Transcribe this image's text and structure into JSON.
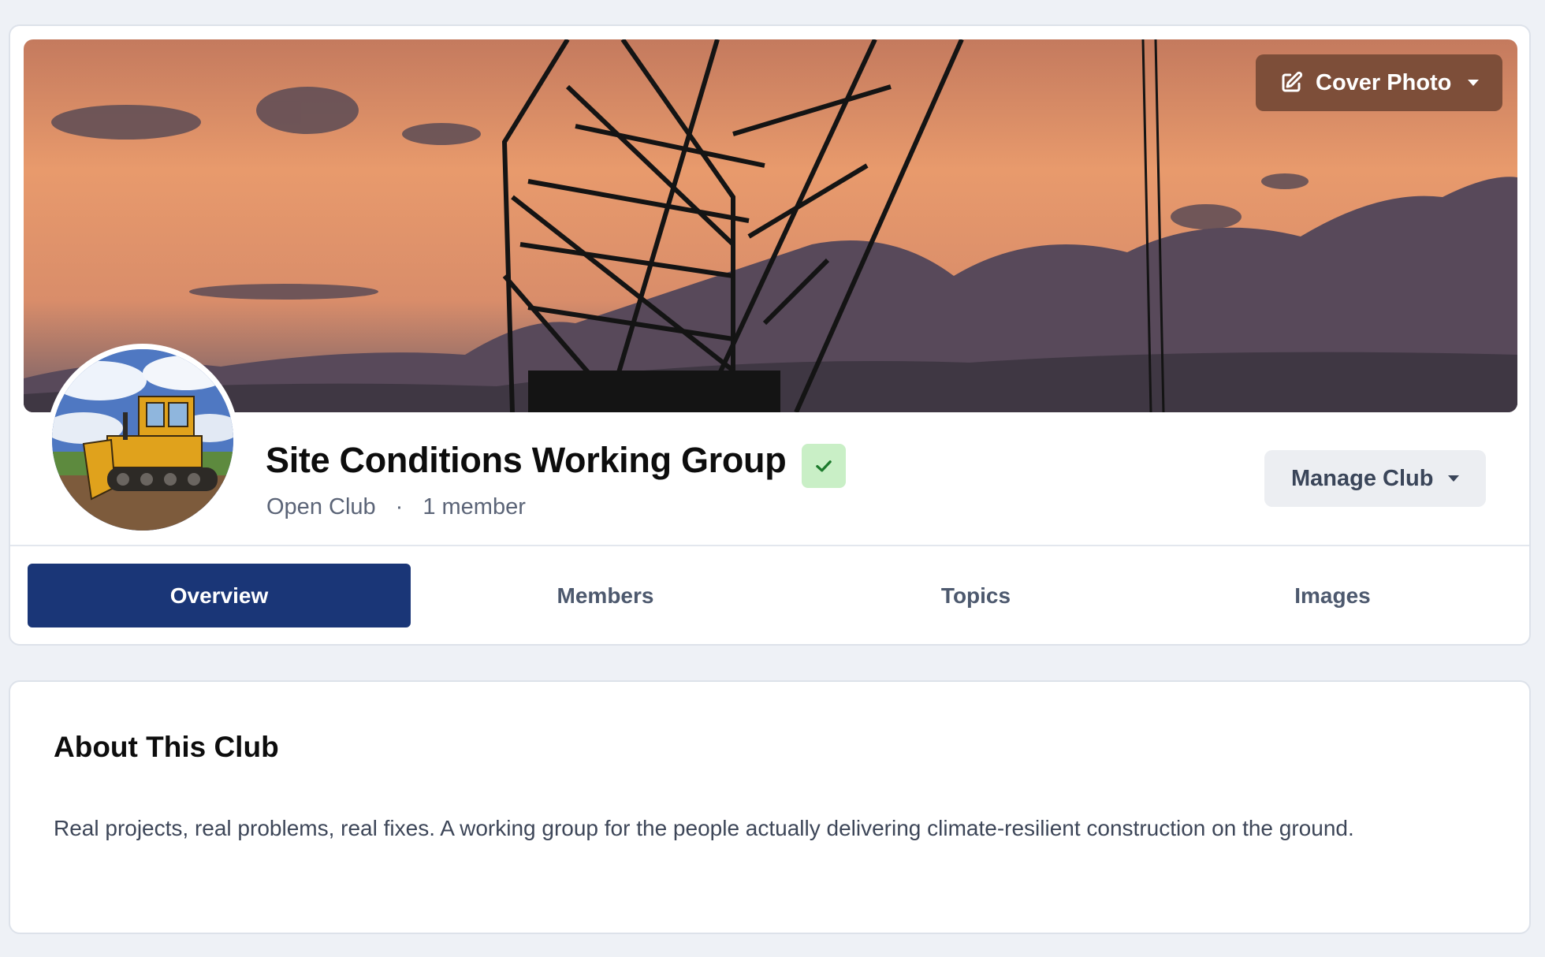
{
  "club": {
    "cover_button_label": "Cover Photo",
    "title": "Site Conditions Working Group",
    "type": "Open Club",
    "separator": "·",
    "member_count": "1 member",
    "manage_button_label": "Manage Club"
  },
  "tabs": [
    {
      "label": "Overview",
      "active": true
    },
    {
      "label": "Members",
      "active": false
    },
    {
      "label": "Topics",
      "active": false
    },
    {
      "label": "Images",
      "active": false
    }
  ],
  "about": {
    "title": "About This Club",
    "description": "Real projects, real problems, real fixes. A working group for the people actually delivering climate-resilient construction on the ground."
  },
  "icons": {
    "cover_button": "edit-icon",
    "verified": "check-icon",
    "dropdown": "caret-down-icon"
  },
  "colors": {
    "primary": "#1a3677",
    "cover_button_bg": "#7d4e39",
    "verified_bg": "#c9efc6",
    "verified_check": "#1c7a2c",
    "page_bg": "#eef1f6"
  }
}
